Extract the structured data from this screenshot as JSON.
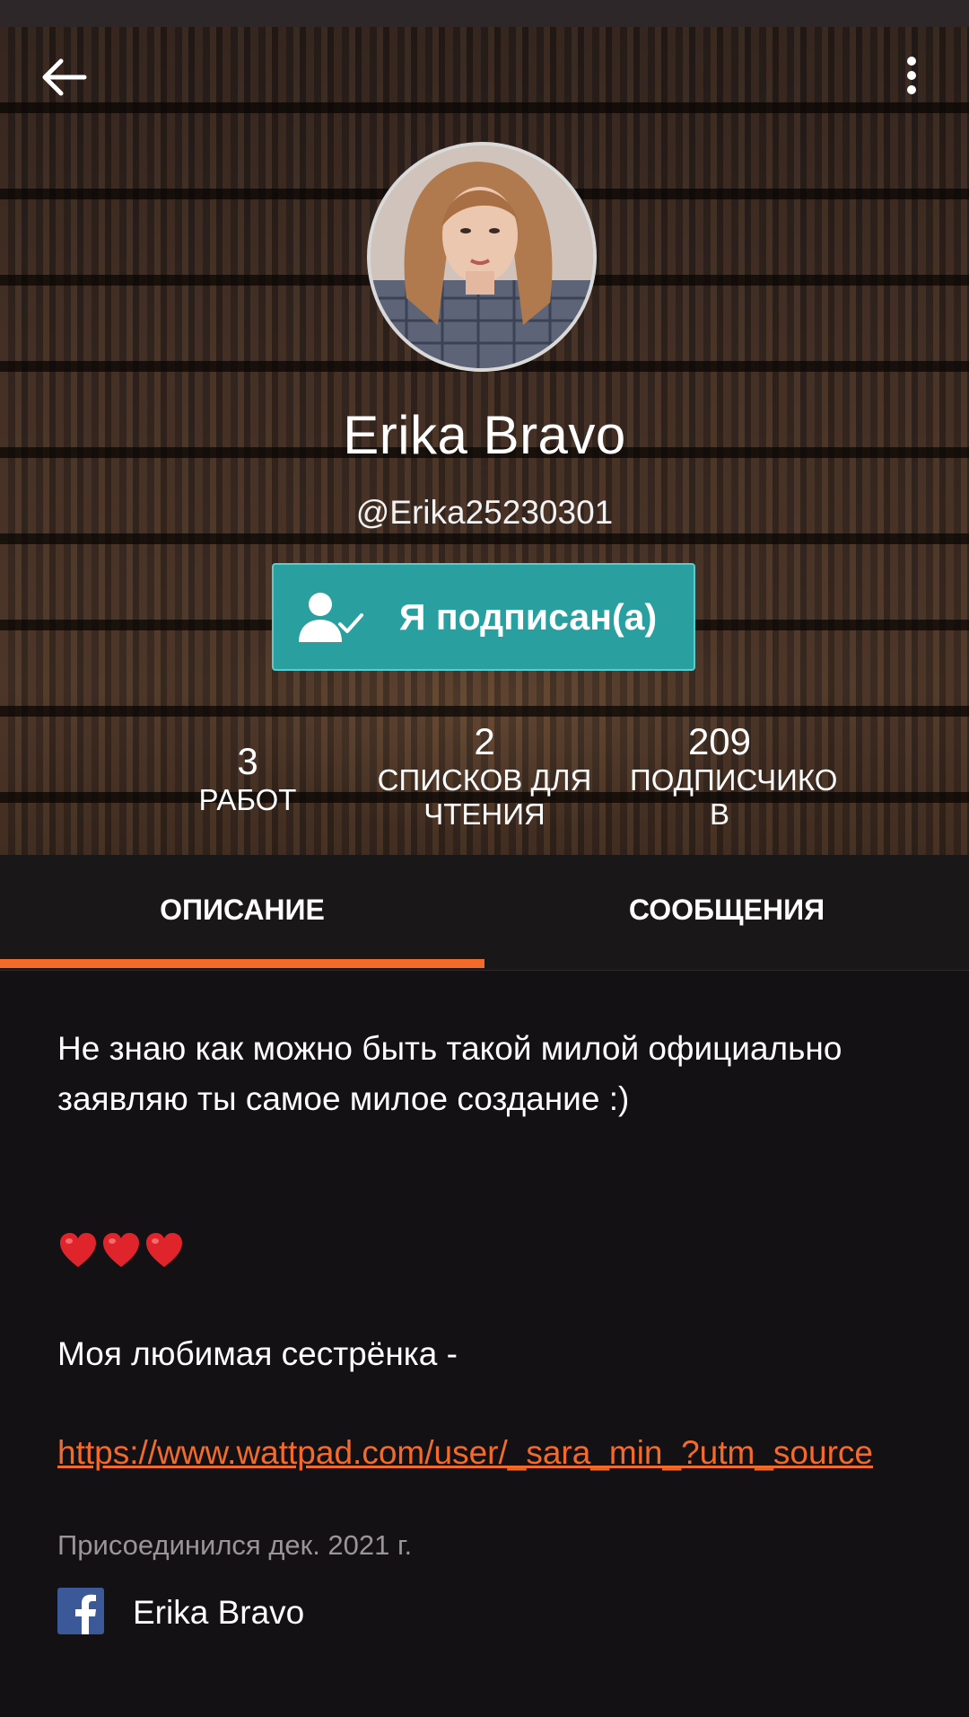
{
  "header": {
    "back_icon": "arrow-left-icon",
    "more_icon": "more-vertical-icon"
  },
  "profile": {
    "name": "Erika Bravo",
    "handle": "@Erika25230301",
    "follow_label": "Я подписан(а)",
    "follow_icon": "user-check-icon",
    "follow_color": "#2a9fa0"
  },
  "stats": [
    {
      "value": "3",
      "label": "РАБОТ"
    },
    {
      "value": "2",
      "label": "СПИСКОВ ДЛЯ ЧТЕНИЯ"
    },
    {
      "value": "209",
      "label": "ПОДПИСЧИКО В"
    }
  ],
  "tabs": [
    {
      "label": "ОПИСАНИЕ",
      "active": true
    },
    {
      "label": "СООБЩЕНИЯ",
      "active": false
    }
  ],
  "accent_color": "#f36b2b",
  "about": {
    "description": "Не знаю как можно быть такой милой официально заявляю ты самое милое создание :)",
    "hearts": "❤️❤️❤️",
    "sister_text": "Моя любимая сестрёнка -",
    "link": "https://www.wattpad.com/user/_sara_min_?utm_source",
    "joined": "Присоединился дек. 2021 г.",
    "facebook_icon": "facebook-icon",
    "facebook_name": "Erika Bravo"
  }
}
